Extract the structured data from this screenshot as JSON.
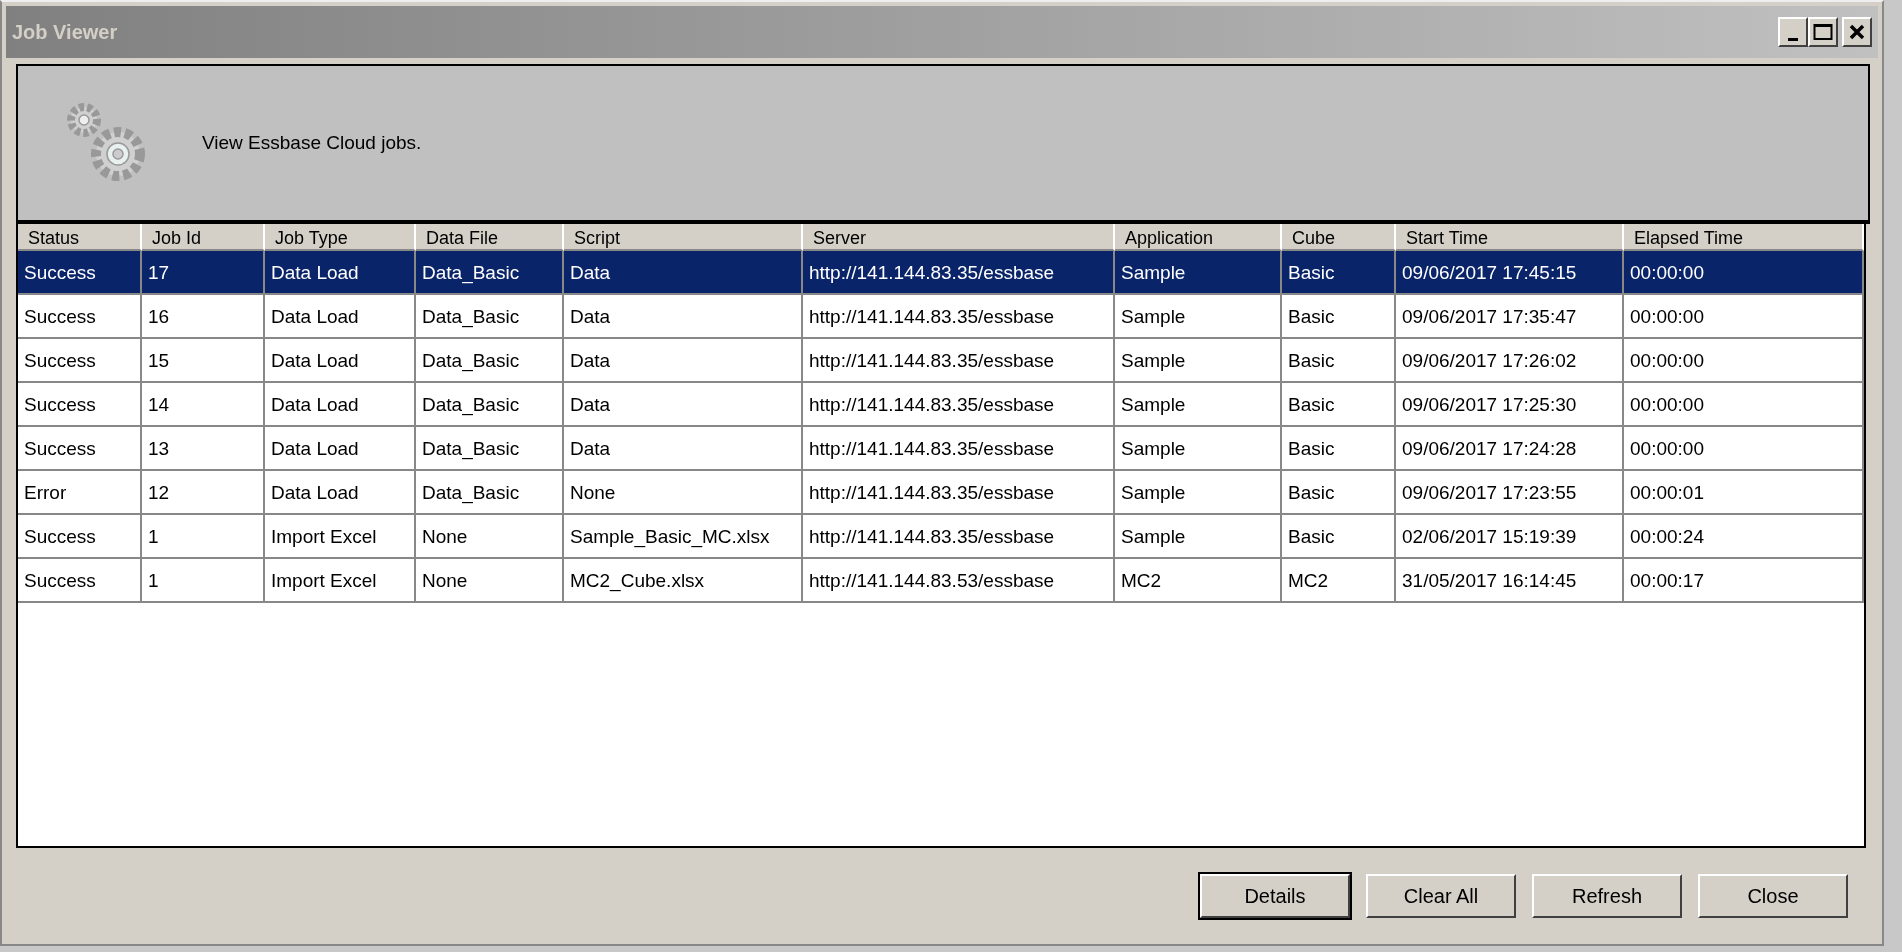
{
  "window": {
    "title": "Job Viewer"
  },
  "header": {
    "text": "View Essbase Cloud jobs."
  },
  "table": {
    "columns": [
      "Status",
      "Job Id",
      "Job Type",
      "Data File",
      "Script",
      "Server",
      "Application",
      "Cube",
      "Start Time",
      "Elapsed Time"
    ],
    "rows": [
      {
        "selected": true,
        "cells": [
          "Success",
          "17",
          "Data Load",
          "Data_Basic",
          "Data",
          "http://141.144.83.35/essbase",
          "Sample",
          "Basic",
          "09/06/2017 17:45:15",
          "00:00:00"
        ]
      },
      {
        "selected": false,
        "cells": [
          "Success",
          "16",
          "Data Load",
          "Data_Basic",
          "Data",
          "http://141.144.83.35/essbase",
          "Sample",
          "Basic",
          "09/06/2017 17:35:47",
          "00:00:00"
        ]
      },
      {
        "selected": false,
        "cells": [
          "Success",
          "15",
          "Data Load",
          "Data_Basic",
          "Data",
          "http://141.144.83.35/essbase",
          "Sample",
          "Basic",
          "09/06/2017 17:26:02",
          "00:00:00"
        ]
      },
      {
        "selected": false,
        "cells": [
          "Success",
          "14",
          "Data Load",
          "Data_Basic",
          "Data",
          "http://141.144.83.35/essbase",
          "Sample",
          "Basic",
          "09/06/2017 17:25:30",
          "00:00:00"
        ]
      },
      {
        "selected": false,
        "cells": [
          "Success",
          "13",
          "Data Load",
          "Data_Basic",
          "Data",
          "http://141.144.83.35/essbase",
          "Sample",
          "Basic",
          "09/06/2017 17:24:28",
          "00:00:00"
        ]
      },
      {
        "selected": false,
        "cells": [
          "Error",
          "12",
          "Data Load",
          "Data_Basic",
          "None",
          "http://141.144.83.35/essbase",
          "Sample",
          "Basic",
          "09/06/2017 17:23:55",
          "00:00:01"
        ]
      },
      {
        "selected": false,
        "cells": [
          "Success",
          "1",
          "Import Excel",
          "None",
          "Sample_Basic_MC.xlsx",
          "http://141.144.83.35/essbase",
          "Sample",
          "Basic",
          "02/06/2017 15:19:39",
          "00:00:24"
        ]
      },
      {
        "selected": false,
        "cells": [
          "Success",
          "1",
          "Import Excel",
          "None",
          "MC2_Cube.xlsx",
          "http://141.144.83.53/essbase",
          "MC2",
          "MC2",
          "31/05/2017 16:14:45",
          "00:00:17"
        ]
      }
    ]
  },
  "buttons": [
    {
      "label": "Details",
      "default": true
    },
    {
      "label": "Clear All",
      "default": false
    },
    {
      "label": "Refresh",
      "default": false
    },
    {
      "label": "Close",
      "default": false
    }
  ]
}
